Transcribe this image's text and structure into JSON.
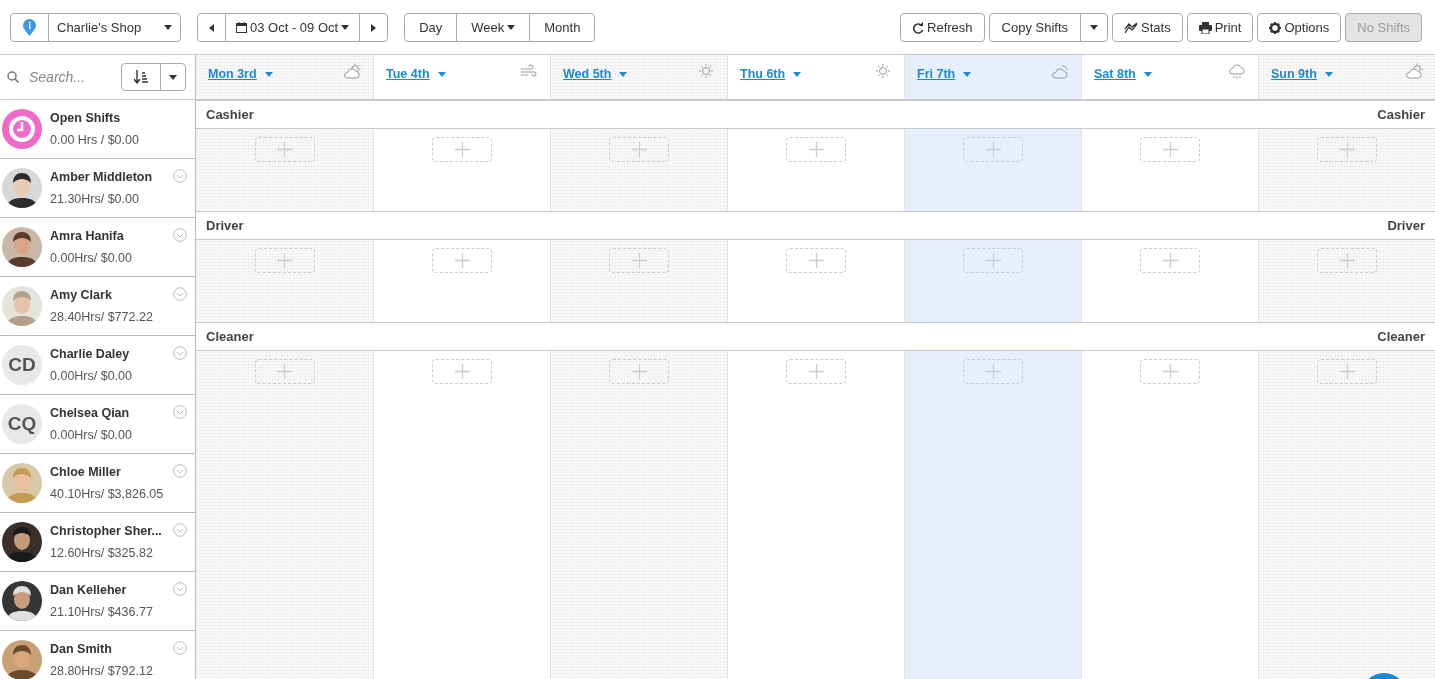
{
  "toolbar": {
    "location": "Charlie's Shop",
    "date_range": "03 Oct - 09 Oct",
    "views": [
      {
        "label": "Day",
        "caret": false
      },
      {
        "label": "Week",
        "caret": true
      },
      {
        "label": "Month",
        "caret": false
      }
    ],
    "actions": [
      {
        "label": "Refresh",
        "kind": "refresh",
        "disabled": false
      },
      {
        "label": "Copy Shifts",
        "kind": "split",
        "disabled": false
      },
      {
        "label": "Stats",
        "kind": "stats",
        "disabled": false
      },
      {
        "label": "Print",
        "kind": "print",
        "disabled": false
      },
      {
        "label": "Options",
        "kind": "options",
        "disabled": false
      },
      {
        "label": "No Shifts",
        "kind": "plain",
        "disabled": true
      }
    ]
  },
  "search": {
    "placeholder": "Search..."
  },
  "days": [
    {
      "label": "Mon 3rd",
      "kind": "partly-cloudy",
      "selected": false
    },
    {
      "label": "Tue 4th",
      "kind": "wind",
      "selected": false
    },
    {
      "label": "Wed 5th",
      "kind": "sun",
      "selected": false
    },
    {
      "label": "Thu 6th",
      "kind": "sun",
      "selected": false
    },
    {
      "label": "Fri 7th",
      "kind": "cloudy",
      "selected": true
    },
    {
      "label": "Sat 8th",
      "kind": "rain",
      "selected": false
    },
    {
      "label": "Sun 9th",
      "kind": "partly-cloudy",
      "selected": false
    }
  ],
  "staff": [
    {
      "name": "Open Shifts",
      "summary": "0.00 Hrs / $0.00",
      "kind": "open"
    },
    {
      "name": "Amber Middleton",
      "summary": "21.30Hrs/ $0.00"
    },
    {
      "name": "Amra Hanifa",
      "summary": "0.00Hrs/ $0.00"
    },
    {
      "name": "Amy Clark",
      "summary": "28.40Hrs/ $772.22"
    },
    {
      "name": "Charlie Daley",
      "summary": "0.00Hrs/ $0.00",
      "kind": "initials",
      "initials": "CD"
    },
    {
      "name": "Chelsea Qian",
      "summary": "0.00Hrs/ $0.00",
      "kind": "initials",
      "initials": "CQ"
    },
    {
      "name": "Chloe Miller",
      "summary": "40.10Hrs/ $3,826.05"
    },
    {
      "name": "Christopher Sher...",
      "summary": "12.60Hrs/ $325.82"
    },
    {
      "name": "Dan Kelleher",
      "summary": "21.10Hrs/ $436.77"
    },
    {
      "name": "Dan Smith",
      "summary": "28.80Hrs/ $792.12"
    }
  ],
  "roles": [
    {
      "label": "Cashier",
      "label_right": "Cashier"
    },
    {
      "label": "Driver",
      "label_right": "Driver"
    },
    {
      "label": "Cleaner",
      "label_right": "Cleaner"
    }
  ]
}
